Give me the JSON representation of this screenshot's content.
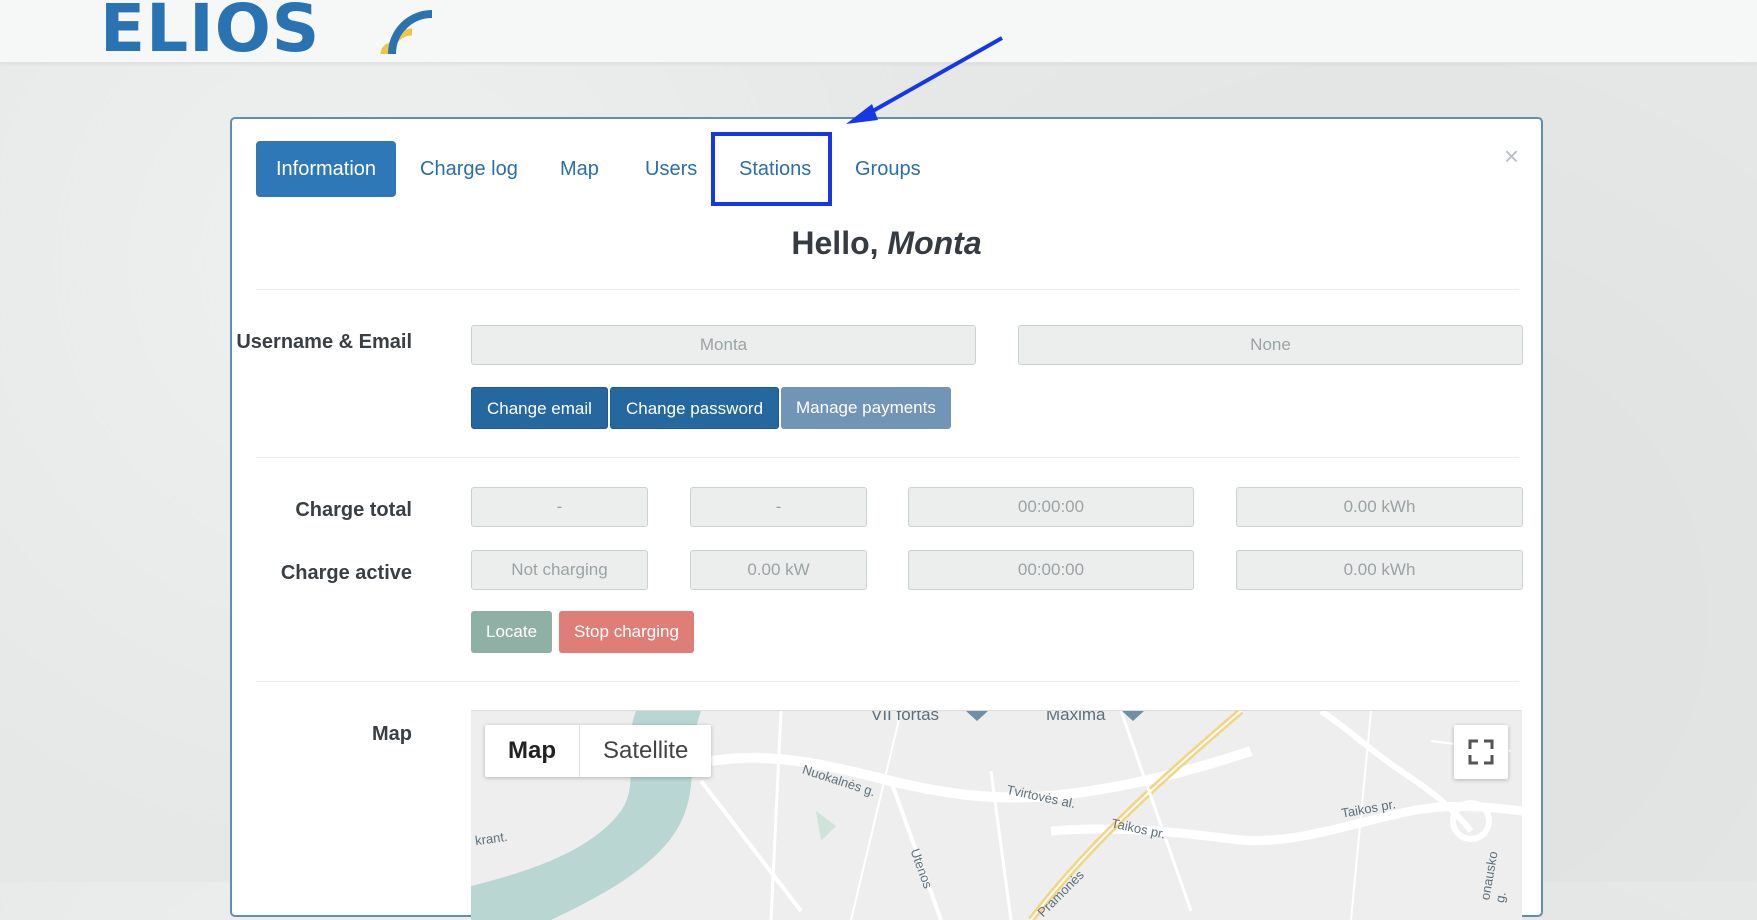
{
  "brand": {
    "logo_text": "ELIOS",
    "logo_color": "#2a73b2",
    "arc_colors": [
      "#f2c544",
      "#2a73b2"
    ]
  },
  "tabs": [
    {
      "label": "Information",
      "active": true
    },
    {
      "label": "Charge log"
    },
    {
      "label": "Map"
    },
    {
      "label": "Users"
    },
    {
      "label": "Stations"
    },
    {
      "label": "Groups"
    }
  ],
  "close_label": "×",
  "greeting": {
    "prefix": "Hello, ",
    "name": "Monta"
  },
  "account": {
    "label": "Username & Email",
    "username": "Monta",
    "email": "None",
    "buttons": {
      "change_email": "Change email",
      "change_password": "Change password",
      "manage_payments": "Manage payments"
    }
  },
  "charge_total": {
    "label": "Charge total",
    "values": [
      "-",
      "-",
      "00:00:00",
      "0.00 kWh"
    ]
  },
  "charge_active": {
    "label": "Charge active",
    "values": [
      "Not charging",
      "0.00 kW",
      "00:00:00",
      "0.00 kWh"
    ]
  },
  "actions": {
    "locate": "Locate",
    "stop": "Stop charging"
  },
  "map_section": {
    "label": "Map",
    "toggle": {
      "map": "Map",
      "satellite": "Satellite"
    },
    "places": [
      "VII fortas",
      "Maxima",
      "Nuokalnės g.",
      "Tvirtovės al.",
      "Taikos pr.",
      "Taikos pr.",
      "krant.",
      "Utenos",
      "Pramonės",
      "onausko g."
    ]
  },
  "annotation": {
    "highlight_color": "#1537e6",
    "target_tab": "Stations"
  }
}
